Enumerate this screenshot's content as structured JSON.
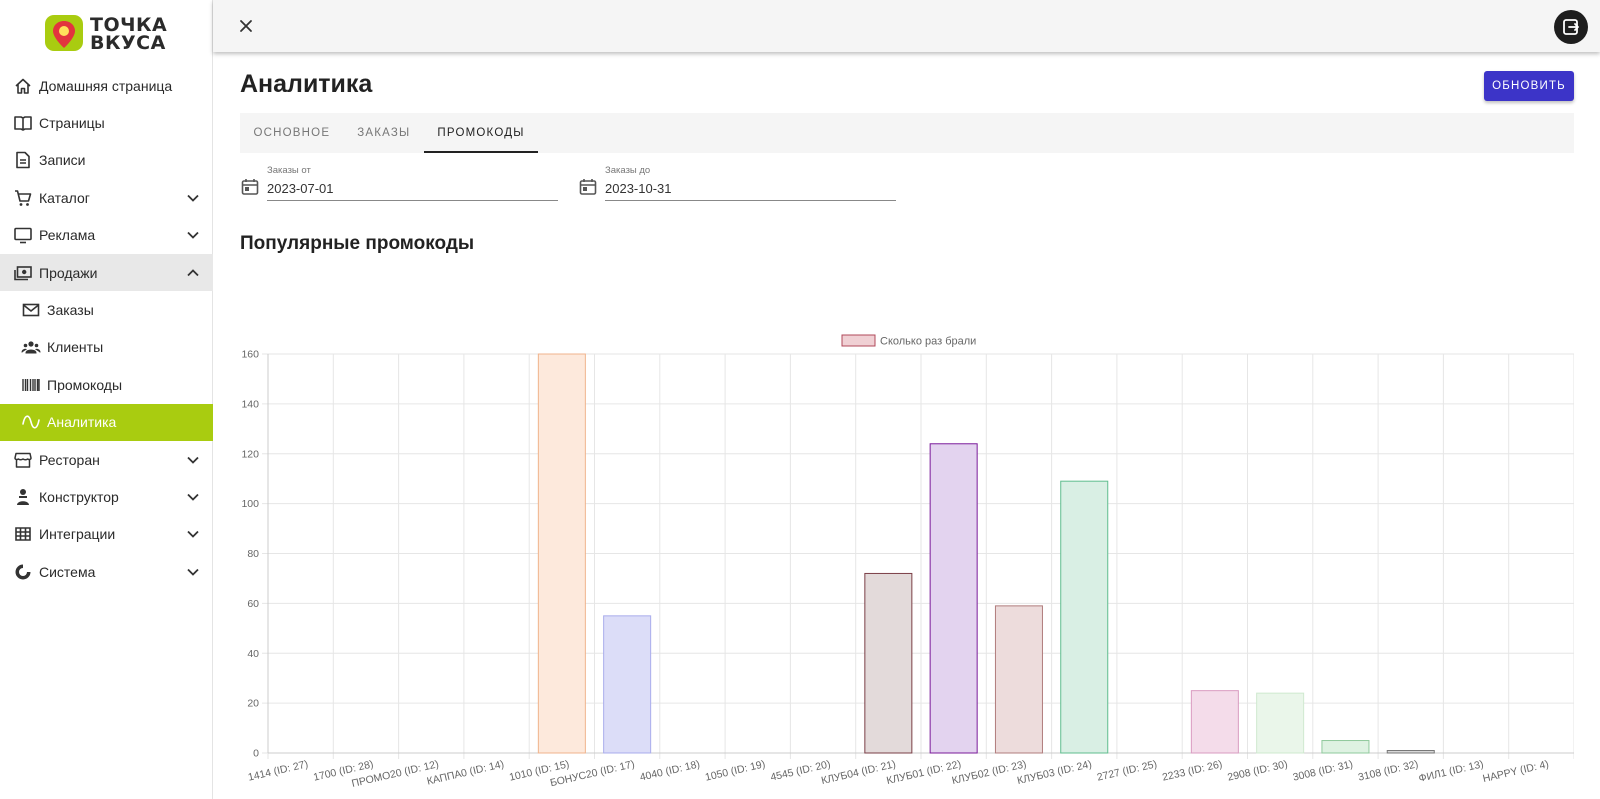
{
  "logo": {
    "line1": "ТОЧКА",
    "line2": "ВКУСА"
  },
  "sidebar": {
    "items": [
      {
        "label": "Домашняя страница",
        "icon": "home-icon"
      },
      {
        "label": "Страницы",
        "icon": "book-icon"
      },
      {
        "label": "Записи",
        "icon": "document-icon"
      },
      {
        "label": "Каталог",
        "icon": "cart-icon",
        "chevron": "down"
      },
      {
        "label": "Реклама",
        "icon": "monitor-icon",
        "chevron": "down"
      },
      {
        "label": "Продажи",
        "icon": "cash-icon",
        "chevron": "up"
      },
      {
        "label": "Заказы",
        "icon": "mail-icon"
      },
      {
        "label": "Клиенты",
        "icon": "people-icon"
      },
      {
        "label": "Промокоды",
        "icon": "barcode-icon"
      },
      {
        "label": "Аналитика",
        "icon": "wave-icon"
      },
      {
        "label": "Ресторан",
        "icon": "store-icon",
        "chevron": "down"
      },
      {
        "label": "Конструктор",
        "icon": "chef-icon",
        "chevron": "down"
      },
      {
        "label": "Интеграции",
        "icon": "grid-icon",
        "chevron": "down"
      },
      {
        "label": "Система",
        "icon": "donut-icon",
        "chevron": "down"
      }
    ]
  },
  "page": {
    "title": "Аналитика",
    "refresh_label": "ОБНОВИТЬ",
    "tabs": [
      {
        "label": "ОСНОВНОЕ"
      },
      {
        "label": "ЗАКАЗЫ"
      },
      {
        "label": "ПРОМОКОДЫ"
      }
    ],
    "active_tab": "ПРОМОКОДЫ",
    "date_from": {
      "label": "Заказы от",
      "value": "2023-07-01"
    },
    "date_to": {
      "label": "Заказы до",
      "value": "2023-10-31"
    },
    "section_title": "Популярные промокоды"
  },
  "colors": {
    "accent": "#a9cc10",
    "button": "#3c34c8"
  },
  "chart_data": {
    "type": "bar",
    "categories": [
      "1414 (ID: 27)",
      "1700 (ID: 28)",
      "ПРОМО20 (ID: 12)",
      "КАППА0 (ID: 14)",
      "1010 (ID: 15)",
      "БОНУС20 (ID: 17)",
      "4040 (ID: 18)",
      "1050 (ID: 19)",
      "4545 (ID: 20)",
      "КЛУБ04 (ID: 21)",
      "КЛУБ01 (ID: 22)",
      "КЛУБ02 (ID: 23)",
      "КЛУБ03 (ID: 24)",
      "2727 (ID: 25)",
      "2233 (ID: 26)",
      "2908 (ID: 30)",
      "3008 (ID: 31)",
      "3108 (ID: 32)",
      "ФИЛ1 (ID: 13)",
      "HAPPY (ID: 4)"
    ],
    "series": [
      {
        "name": "Сколько раз брали",
        "values": [
          0,
          0,
          0,
          0,
          160,
          55,
          0,
          0,
          0,
          72,
          124,
          59,
          109,
          0,
          25,
          24,
          5,
          1,
          0,
          0
        ]
      }
    ],
    "bar_colors": [
      {
        "fill": "#fde9dc",
        "stroke": "#f0b38c"
      },
      {
        "fill": "#dcddf8",
        "stroke": "#a9acec"
      },
      {
        "fill": "#e3dada",
        "stroke": "#7a3e46"
      },
      {
        "fill": "#e3d3ef",
        "stroke": "#7a1a9a"
      },
      {
        "fill": "#eddcdc",
        "stroke": "#b07c7c"
      },
      {
        "fill": "#d9efe4",
        "stroke": "#5fbd8e"
      },
      {
        "fill": "#f4dcea",
        "stroke": "#d99bc0"
      },
      {
        "fill": "#eaf6ea",
        "stroke": "#cfe9cf"
      },
      {
        "fill": "#def2e2",
        "stroke": "#8fc99c"
      },
      {
        "fill": "#d8d8d8",
        "stroke": "#777777"
      }
    ],
    "colored_bar_indices": [
      4,
      5,
      9,
      10,
      11,
      12,
      14,
      15,
      16,
      17
    ],
    "legend_swatch": {
      "fill": "#f0d0d4",
      "stroke": "#b0485a"
    },
    "ylim": [
      0,
      160
    ],
    "yticks": [
      0,
      20,
      40,
      60,
      80,
      100,
      120,
      140,
      160
    ],
    "grid": true,
    "legend_position": "top-center"
  }
}
